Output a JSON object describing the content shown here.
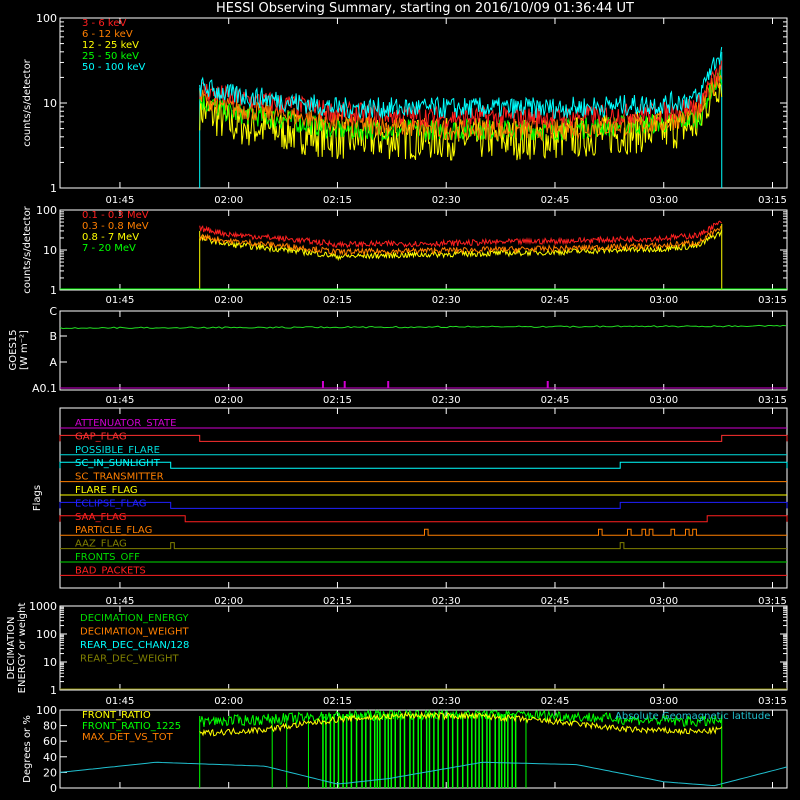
{
  "title": "HESSI Observing Summary, starting on 2016/10/09 01:36:44 UT",
  "time_ticks": [
    "01:45",
    "02:00",
    "02:15",
    "02:30",
    "02:45",
    "03:00",
    "03:15"
  ],
  "chart_data": [
    {
      "type": "line",
      "name": "xray-lightcurves",
      "ylabel": "counts/s/detector",
      "yscale": "log",
      "ylim": [
        1,
        100
      ],
      "y_ticks": [
        "1",
        "10",
        "100"
      ],
      "x_range": [
        "01:36:44",
        "03:17:00"
      ],
      "series": [
        {
          "name": "3 - 6 keV",
          "color": "#ff2020",
          "x": [
            "01:56",
            "02:00",
            "02:15",
            "02:30",
            "02:45",
            "03:00",
            "03:05",
            "03:08"
          ],
          "values": [
            15,
            12,
            8,
            7,
            7,
            8,
            10,
            25
          ]
        },
        {
          "name": "6 - 12 keV",
          "color": "#ff7f00",
          "x": [
            "01:56",
            "02:00",
            "02:15",
            "02:30",
            "02:45",
            "03:00",
            "03:05",
            "03:08"
          ],
          "values": [
            12,
            9,
            6,
            5,
            5,
            6,
            8,
            22
          ]
        },
        {
          "name": "12 - 25 keV",
          "color": "#ffff00",
          "x": [
            "01:56",
            "02:00",
            "02:15",
            "02:30",
            "02:45",
            "03:00",
            "03:05",
            "03:08"
          ],
          "values": [
            9,
            6,
            4,
            4,
            4,
            5,
            6,
            20
          ]
        },
        {
          "name": "25 - 50 keV",
          "color": "#00ff00",
          "x": [
            "01:56",
            "02:00",
            "02:15",
            "02:30",
            "02:45",
            "03:00",
            "03:05",
            "03:08"
          ],
          "values": [
            11,
            8,
            5,
            5,
            5,
            6,
            7,
            22
          ]
        },
        {
          "name": "50 - 100 keV",
          "color": "#00ffff",
          "x": [
            "01:56",
            "02:00",
            "02:15",
            "02:30",
            "02:45",
            "03:00",
            "03:05",
            "03:08"
          ],
          "values": [
            16,
            13,
            9,
            9,
            9,
            10,
            12,
            40
          ]
        }
      ]
    },
    {
      "type": "line",
      "name": "gamma-lightcurves",
      "ylabel": "counts/s/detector",
      "yscale": "log",
      "ylim": [
        1,
        100
      ],
      "y_ticks": [
        "1",
        "10",
        "100"
      ],
      "series": [
        {
          "name": "0.1 - 0.3 MeV",
          "color": "#ff2020",
          "x": [
            "01:56",
            "02:00",
            "02:15",
            "02:30",
            "02:45",
            "03:00",
            "03:05",
            "03:08"
          ],
          "values": [
            35,
            25,
            14,
            15,
            17,
            20,
            24,
            50
          ]
        },
        {
          "name": "0.3 - 0.8 MeV",
          "color": "#ff7f00",
          "x": [
            "01:56",
            "02:00",
            "02:15",
            "02:30",
            "02:45",
            "03:00",
            "03:05",
            "03:08"
          ],
          "values": [
            22,
            17,
            9,
            10,
            11,
            13,
            16,
            35
          ]
        },
        {
          "name": "0.8 - 7 MeV",
          "color": "#ffff00",
          "x": [
            "01:56",
            "02:00",
            "02:15",
            "02:30",
            "02:45",
            "03:00",
            "03:05",
            "03:08"
          ],
          "values": [
            20,
            14,
            7,
            8,
            9,
            11,
            13,
            28
          ]
        },
        {
          "name": "7 - 20 MeV",
          "color": "#00ff00",
          "x": [
            "01:36:44",
            "03:17"
          ],
          "values": [
            1,
            1
          ]
        }
      ]
    },
    {
      "type": "line",
      "name": "goes",
      "ylabel": "GOES15",
      "ylabel_unit": "[W m⁻²]",
      "y_ticks": [
        "A0.1",
        "A",
        "B",
        "C"
      ],
      "series": [
        {
          "name": "goes-long",
          "color": "#22dd22",
          "level": "B6"
        }
      ],
      "spikes_x": [
        "02:13",
        "02:16",
        "02:22",
        "02:44"
      ]
    },
    {
      "type": "table",
      "name": "flags",
      "ylabel": "Flags",
      "rows": [
        {
          "label": "ATTENUATOR_STATE",
          "color": "#d000d0",
          "on": []
        },
        {
          "label": "GAP_FLAG",
          "color": "#ff3030",
          "on": [
            [
              "01:36:44",
              "01:56"
            ],
            [
              "03:08",
              "03:17"
            ]
          ]
        },
        {
          "label": "POSSIBLE_FLARE",
          "color": "#00dddd",
          "on": []
        },
        {
          "label": "SC_IN_SUNLIGHT",
          "color": "#00ffff",
          "on": [
            [
              "01:36:44",
              "01:52"
            ],
            [
              "02:54",
              "03:17"
            ]
          ]
        },
        {
          "label": "SC_TRANSMITTER",
          "color": "#ff7f00",
          "on": []
        },
        {
          "label": "FLARE_FLAG",
          "color": "#ffff00",
          "on": []
        },
        {
          "label": "ECLIPSE_FLAG",
          "color": "#2020ff",
          "on": [
            [
              "01:36:44",
              "01:52"
            ],
            [
              "02:54",
              "03:17"
            ]
          ]
        },
        {
          "label": "SAA_FLAG",
          "color": "#ff2020",
          "on": [
            [
              "01:36:44",
              "01:54"
            ],
            [
              "03:06",
              "03:17"
            ]
          ]
        },
        {
          "label": "PARTICLE_FLAG",
          "color": "#ff7f00",
          "on": [
            [
              "02:27",
              "02:27:30"
            ],
            [
              "02:51",
              "02:51:30"
            ],
            [
              "02:55",
              "02:55:30"
            ],
            [
              "02:57",
              "02:57:30"
            ],
            [
              "02:58",
              "02:58:30"
            ],
            [
              "03:01",
              "03:01:30"
            ],
            [
              "03:03",
              "03:03:30"
            ],
            [
              "03:04",
              "03:04:30"
            ]
          ]
        },
        {
          "label": "AAZ_FLAG",
          "color": "#808000",
          "on": [
            [
              "01:52",
              "01:52:30"
            ],
            [
              "02:54",
              "02:54:30"
            ]
          ]
        },
        {
          "label": "FRONTS_OFF",
          "color": "#00dd00",
          "on": []
        },
        {
          "label": "BAD_PACKETS",
          "color": "#ff2020",
          "on": []
        }
      ]
    },
    {
      "type": "line",
      "name": "decimation",
      "ylabel": "DECIMATION",
      "ylabel2": "ENERGY or weight",
      "yscale": "log",
      "ylim": [
        1,
        1000
      ],
      "y_ticks": [
        "1",
        "10",
        "100",
        "1000"
      ],
      "series": [
        {
          "name": "DECIMATION_ENERGY",
          "color": "#00dd00"
        },
        {
          "name": "DECIMATION_WEIGHT",
          "color": "#ff7f00"
        },
        {
          "name": "REAR_DEC_CHAN/128",
          "color": "#00ffff"
        },
        {
          "name": "REAR_DEC_WEIGHT",
          "color": "#808000"
        }
      ]
    },
    {
      "type": "line",
      "name": "ratios",
      "ylabel": "Degrees or %",
      "ylim": [
        0,
        100
      ],
      "y_ticks": [
        "0",
        "20",
        "40",
        "60",
        "80",
        "100"
      ],
      "annotation": "Absolute Geomagnetic latitude",
      "series": [
        {
          "name": "FRONT_RATIO",
          "color": "#ffff00",
          "x": [
            "01:56",
            "02:05",
            "02:15",
            "02:25",
            "02:35",
            "02:45",
            "02:55",
            "03:05",
            "03:08"
          ],
          "values": [
            70,
            75,
            88,
            93,
            92,
            85,
            75,
            72,
            75
          ]
        },
        {
          "name": "FRONT_RATIO_1225",
          "color": "#00ff00",
          "x": [
            "01:56",
            "02:05",
            "02:15",
            "02:25",
            "02:35",
            "02:45",
            "02:55",
            "03:05",
            "03:08"
          ],
          "values": [
            85,
            88,
            92,
            95,
            95,
            93,
            88,
            85,
            87
          ]
        },
        {
          "name": "MAX_DET_VS_TOT",
          "color": "#ff7f00",
          "x": [],
          "values": []
        },
        {
          "name": "Absolute Geomagnetic latitude",
          "color": "#20c0d0",
          "x": [
            "01:36:44",
            "01:50",
            "02:05",
            "02:15",
            "02:22",
            "02:35",
            "02:48",
            "03:00",
            "03:07",
            "03:17"
          ],
          "values": [
            20,
            33,
            28,
            5,
            12,
            33,
            30,
            8,
            3,
            27
          ]
        }
      ]
    }
  ]
}
